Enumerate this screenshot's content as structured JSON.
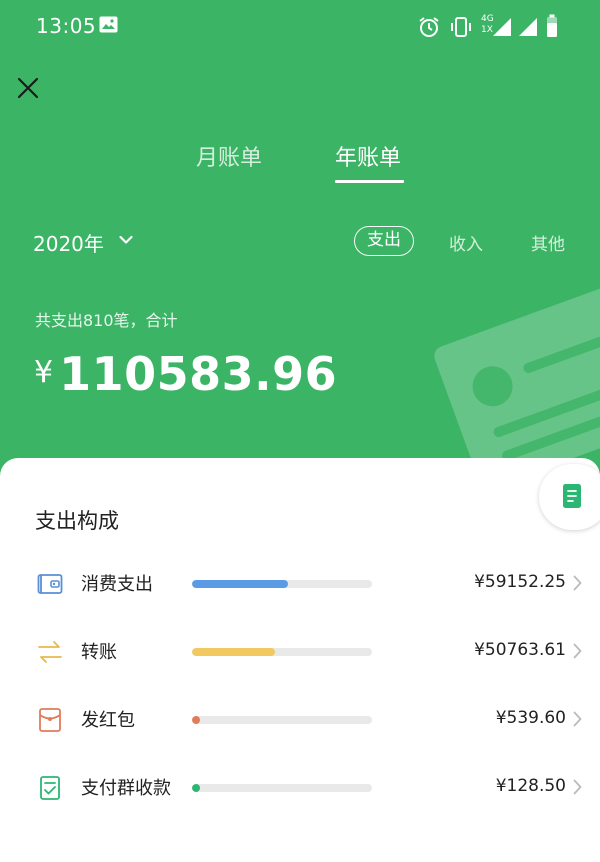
{
  "status_bar": {
    "time": "13:05",
    "network_label_top": "4G",
    "network_label_bottom": "1X"
  },
  "tabs": [
    {
      "label": "月账单",
      "active": false
    },
    {
      "label": "年账单",
      "active": true
    }
  ],
  "year_selector": {
    "value": "2020年"
  },
  "filters": [
    {
      "label": "支出",
      "selected": true
    },
    {
      "label": "收入",
      "selected": false
    },
    {
      "label": "其他",
      "selected": false
    }
  ],
  "summary": {
    "subtitle": "共支出810笔，合计",
    "currency": "¥",
    "total": "110583.96"
  },
  "breakdown": {
    "title": "支出构成",
    "items": [
      {
        "label": "消费支出",
        "amount": "¥59152.25",
        "share": 0.535,
        "color": "#5b9be6",
        "icon": "wallet-icon"
      },
      {
        "label": "转账",
        "amount": "¥50763.61",
        "share": 0.459,
        "color": "#f2c860",
        "icon": "transfer-icon"
      },
      {
        "label": "发红包",
        "amount": "¥539.60",
        "share": 0.005,
        "color": "#e07c5a",
        "icon": "red-envelope-icon"
      },
      {
        "label": "支付群收款",
        "amount": "¥128.50",
        "share": 0.001,
        "color": "#2bb673",
        "icon": "group-payment-icon"
      }
    ]
  },
  "colors": {
    "header_green": "#3cb466",
    "track": "#e9e9e9"
  }
}
